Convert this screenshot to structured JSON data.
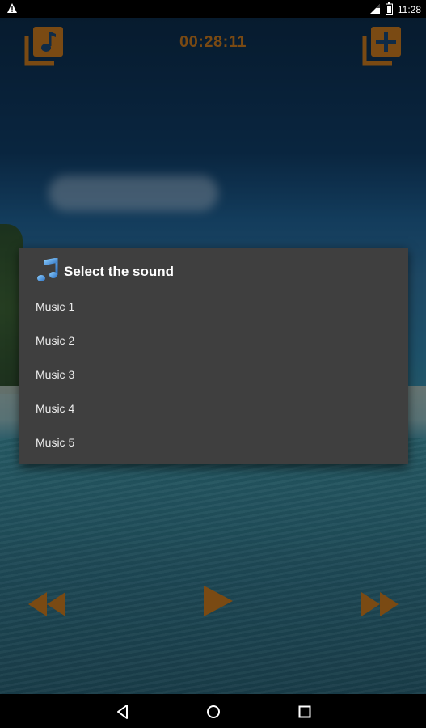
{
  "status_bar": {
    "time": "11:28",
    "icons": [
      "warning-icon",
      "signal-icon",
      "battery-icon"
    ]
  },
  "header": {
    "timer": "00:28:11",
    "left_icon": "music-library-icon",
    "right_icon": "add-icon"
  },
  "dialog": {
    "title": "Select the sound",
    "title_icon": "music-note-icon",
    "items": [
      {
        "label": "Music 1"
      },
      {
        "label": "Music 2"
      },
      {
        "label": "Music 3"
      },
      {
        "label": "Music 4"
      },
      {
        "label": "Music 5"
      }
    ]
  },
  "playback": {
    "icons": [
      "rewind-icon",
      "play-icon",
      "fast-forward-icon"
    ]
  },
  "navigation": {
    "icons": [
      "back-icon",
      "home-icon",
      "recents-icon"
    ]
  },
  "colors": {
    "accent": "#7a4a13",
    "dialog_bg": "#3f3f3f",
    "note_blue": "#3d8fd6"
  }
}
